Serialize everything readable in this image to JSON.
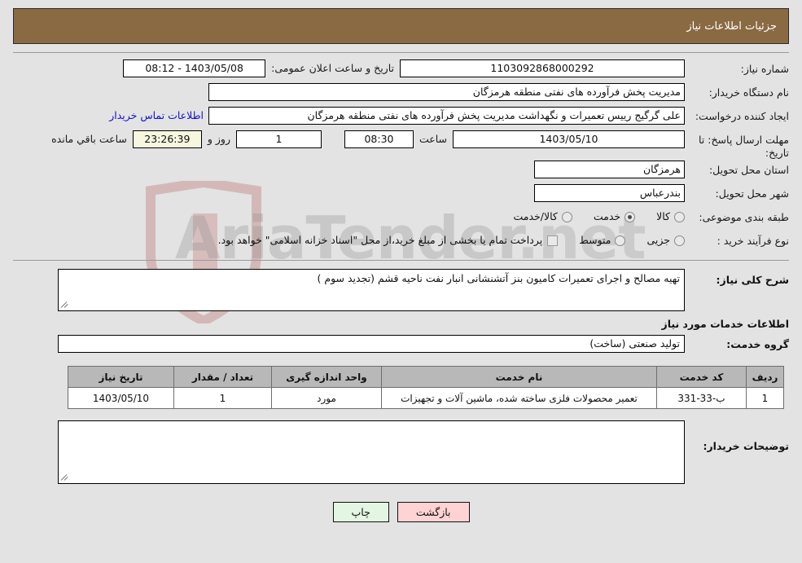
{
  "header": {
    "title": "جزئیات اطلاعات نیاز"
  },
  "watermark": {
    "text": "AriaTender",
    "suffix": ".net",
    "shield": "shield-arrow-icon"
  },
  "form": {
    "need_number_label": "شماره نیاز:",
    "need_number_value": "1103092868000292",
    "public_announce_label": "تاریخ و ساعت اعلان عمومی:",
    "public_announce_value": "1403/05/08 - 08:12",
    "buyer_org_label": "نام دستگاه خریدار:",
    "buyer_org_value": "مدیریت پخش فرآورده های نفتی منطقه هرمزگان",
    "creator_label": "ایجاد کننده درخواست:",
    "creator_value": "علی گرگیج رییس تعمیرات و نگهداشت مدیریت پخش فرآورده های نفتی منطقه هرمزگان",
    "creator_contact_link": "اطلاعات تماس خریدار",
    "deadline_label": "مهلت ارسال پاسخ: تا تاریخ:",
    "deadline_date": "1403/05/10",
    "deadline_time_label": "ساعت",
    "deadline_time": "08:30",
    "days_value": "1",
    "days_label": "روز و",
    "remaining_time": "23:26:39",
    "remaining_label": "ساعت باقي مانده",
    "province_label": "استان محل تحویل:",
    "province_value": "هرمزگان",
    "city_label": "شهر محل تحویل:",
    "city_value": "بندرعباس",
    "category_label": "طبقه بندی موضوعی:",
    "category_options": [
      {
        "label": "کالا",
        "checked": false
      },
      {
        "label": "خدمت",
        "checked": true
      },
      {
        "label": "کالا/خدمت",
        "checked": false
      }
    ],
    "process_label": "نوع فرآیند خرید :",
    "process_options": [
      {
        "label": "جزیی",
        "checked": false
      },
      {
        "label": "متوسط",
        "checked": false
      }
    ],
    "treasury_note": "پرداخت تمام یا بخشی از مبلغ خرید،از محل \"اسناد خزانه اسلامی\" خواهد بود.",
    "treasury_checked": false
  },
  "description": {
    "label": "شرح کلی نیاز:",
    "value": "تهیه مصالح و اجرای تعمیرات کامیون بنز آتشنشانی انبار نفت ناحیه قشم (تجدید سوم )"
  },
  "services": {
    "heading": "اطلاعات خدمات مورد نیاز",
    "group_label": "گروه خدمت:",
    "group_value": "تولید صنعتی (ساخت)",
    "columns": [
      "ردیف",
      "کد خدمت",
      "نام خدمت",
      "واحد اندازه گیری",
      "تعداد / مقدار",
      "تاریخ نیاز"
    ],
    "rows": [
      {
        "row_no": "1",
        "service_code": "ب-33-331",
        "service_name": "تعمیر محصولات فلزی ساخته شده، ماشین آلات و تجهیزات",
        "unit": "مورد",
        "quantity": "1",
        "need_date": "1403/05/10"
      }
    ]
  },
  "buyer_notes": {
    "label": "توضیحات خریدار:",
    "value": ""
  },
  "footer": {
    "print_label": "چاپ",
    "back_label": "بازگشت"
  }
}
